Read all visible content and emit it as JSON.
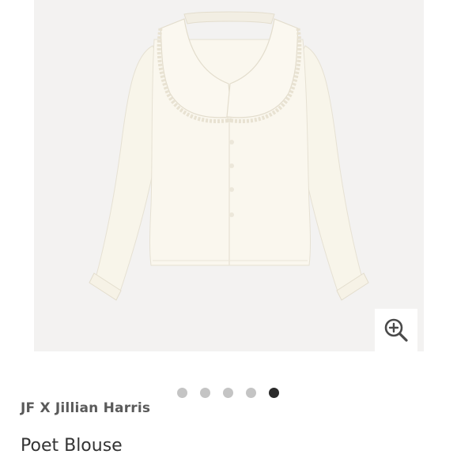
{
  "product": {
    "brand": "JF X Jillian Harris",
    "name": "Poet Blouse"
  },
  "gallery": {
    "image_alt": "Cream long-sleeve blouse with large ruffle-trimmed collar",
    "zoom_icon": "zoom-in-icon",
    "dots": [
      {
        "active": false
      },
      {
        "active": false
      },
      {
        "active": false
      },
      {
        "active": false
      },
      {
        "active": true
      }
    ]
  },
  "colors": {
    "image_background": "#f3f2f1",
    "blouse": "#f8f5ea",
    "dot_inactive": "#c4c4c4",
    "dot_active": "#2a2a2a",
    "brand_text": "#5a5a5a"
  }
}
